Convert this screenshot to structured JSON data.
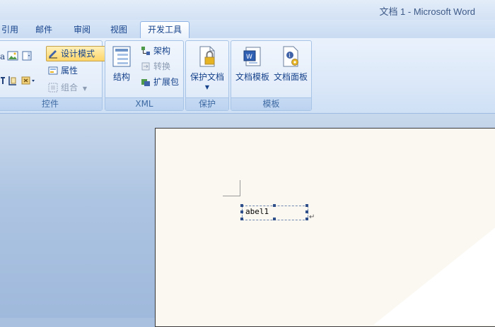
{
  "window": {
    "title": "文档 1 - Microsoft Word"
  },
  "tabs": [
    {
      "label": "引用"
    },
    {
      "label": "邮件"
    },
    {
      "label": "审阅"
    },
    {
      "label": "视图"
    },
    {
      "label": "开发工具",
      "active": true
    }
  ],
  "ribbon": {
    "controls": {
      "label": "控件",
      "design_mode": "设计模式",
      "properties": "属性",
      "group": "组合"
    },
    "xml": {
      "label": "XML",
      "structure": "结构",
      "schema": "架构",
      "transform": "转换",
      "expansion_pack": "扩展包"
    },
    "protect": {
      "label": "保护",
      "protect_document": "保护文档"
    },
    "templates": {
      "label": "模板",
      "document_template": "文档模板",
      "document_panel": "文档面板"
    }
  },
  "document": {
    "field_text": "abel1",
    "paragraph_mark": "↵"
  },
  "colors": {
    "ribbon_bg": "#dbe8f8",
    "text": "#15428b",
    "highlight": "#ffd669",
    "page": "#fbf8f1"
  }
}
